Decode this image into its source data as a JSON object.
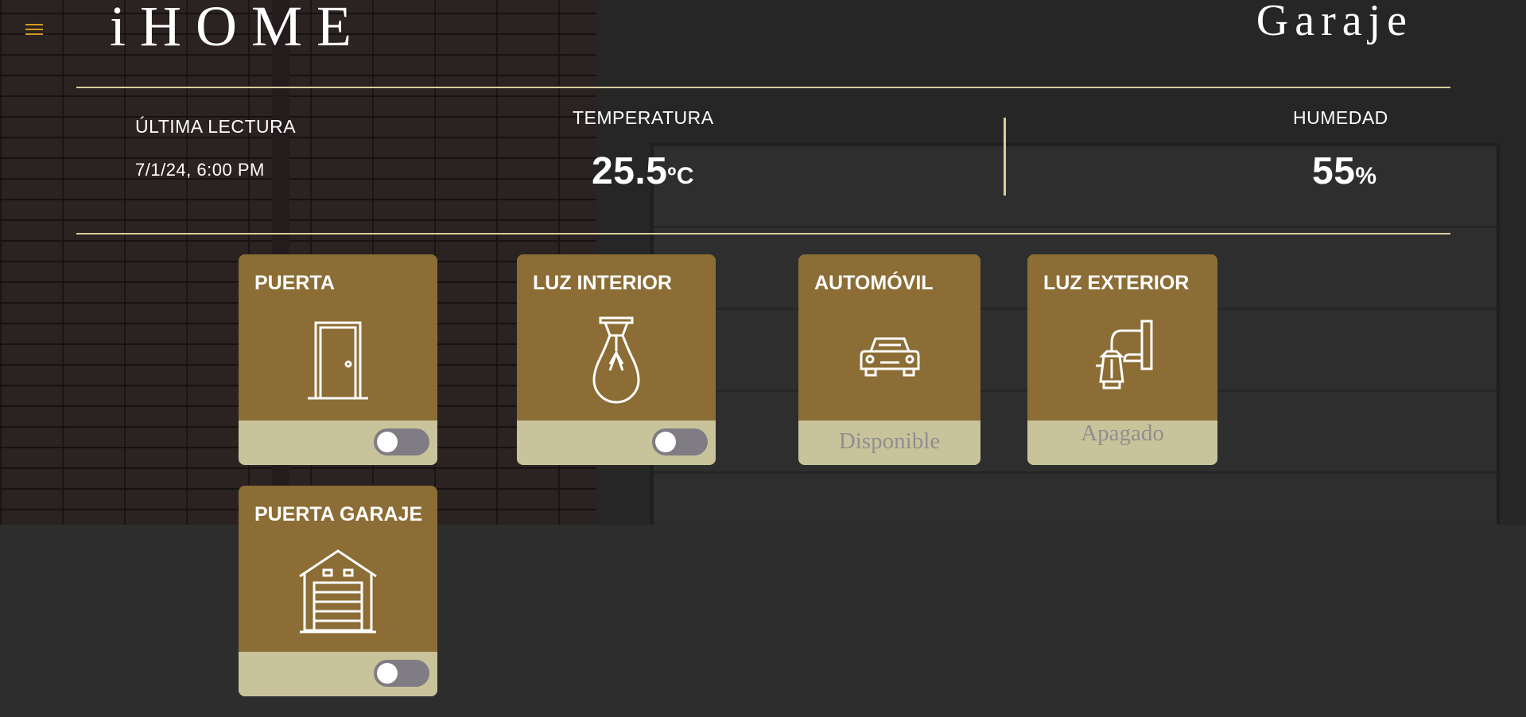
{
  "app": {
    "logo": "iHOME",
    "room_title": "Garaje"
  },
  "colors": {
    "accent": "#d79b1e",
    "card": "#8b6d35",
    "card_footer": "#c9c39c",
    "rule": "#d8cf9c"
  },
  "readings": {
    "last_reading_label": "ÚLTIMA LECTURA",
    "last_reading_value": "7/1/24, 6:00 PM",
    "temperature_label": "TEMPERATURA",
    "temperature_value": "25.5",
    "temperature_unit": "ºC",
    "humidity_label": "HUMEDAD",
    "humidity_value": "55",
    "humidity_unit": "%"
  },
  "devices": {
    "puerta": {
      "title": "PUERTA",
      "icon": "door-icon",
      "toggle_on": false
    },
    "luz_interior": {
      "title": "LUZ INTERIOR",
      "icon": "light-bulb-icon",
      "toggle_on": false
    },
    "automovil": {
      "title": "AUTOMÓVIL",
      "icon": "car-icon",
      "status": "Disponible"
    },
    "luz_exterior": {
      "title": "LUZ EXTERIOR",
      "icon": "wall-lantern-icon",
      "status": "Apagado"
    },
    "puerta_garaje": {
      "title": "PUERTA GARAJE",
      "icon": "garage-icon",
      "toggle_on": false
    }
  }
}
